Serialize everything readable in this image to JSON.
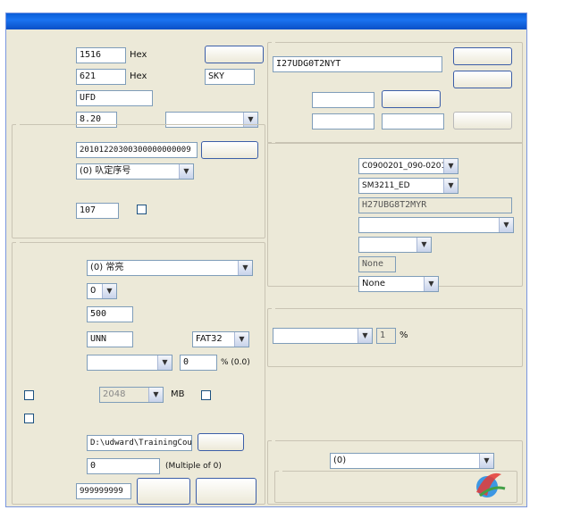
{
  "window": {
    "title": ""
  },
  "basic": {
    "vendor_code_value": "1516",
    "vendor_code_hint": "Hex",
    "product_code_value": "621",
    "product_code_hint": "Hex",
    "vendor_name_value": "SKY",
    "product_name_value": "UFD",
    "product_version_value": "8.20",
    "product_version_select": "",
    "close_label": ""
  },
  "serial": {
    "serial_value": "20101220300300000000009",
    "random_button": "",
    "method_select": "(0) 叺定序号",
    "production_line_value": "107",
    "binary_serial_label": ""
  },
  "flash": {
    "led_mode_select": "(0) 常亮",
    "led_brightness_select": "0",
    "range_value": "500",
    "range_unit": "",
    "disk_label_value": "UNN",
    "fs_type_select": "FAT32",
    "speed_select": "",
    "speed_value": "0",
    "speed_unit": "% (0.0)",
    "capacity_select": "2048",
    "capacity_unit": "MB",
    "copy_path_value": "D:\\udward\\TrainingCourse",
    "browse_button": "",
    "size_value": "0",
    "size_unit": "(Multiple of 0)",
    "max_count_value": "999999999",
    "multi_partition_button": ""
  },
  "settings_file": {
    "file_value": "I27UDG0T2NYT",
    "delete_button": "",
    "save_button": "",
    "password_input": "",
    "password_button": "",
    "new_password_input": "",
    "new_password_confirm": "",
    "modify_button": ""
  },
  "storage": {
    "agent_select": "C0900201_090-0201",
    "controller_select": "SM3211_ED",
    "config_file_value": "H27UBG8T2MYR",
    "flash_model_select": "",
    "channel_select": "",
    "interleave_value": "None",
    "ext_interleave_select": "None"
  },
  "reserve": {
    "mode_select": "",
    "value": "1",
    "unit": "%",
    "note_line1": "",
    "note_line2": ""
  },
  "usb": {
    "select": "(0)"
  }
}
